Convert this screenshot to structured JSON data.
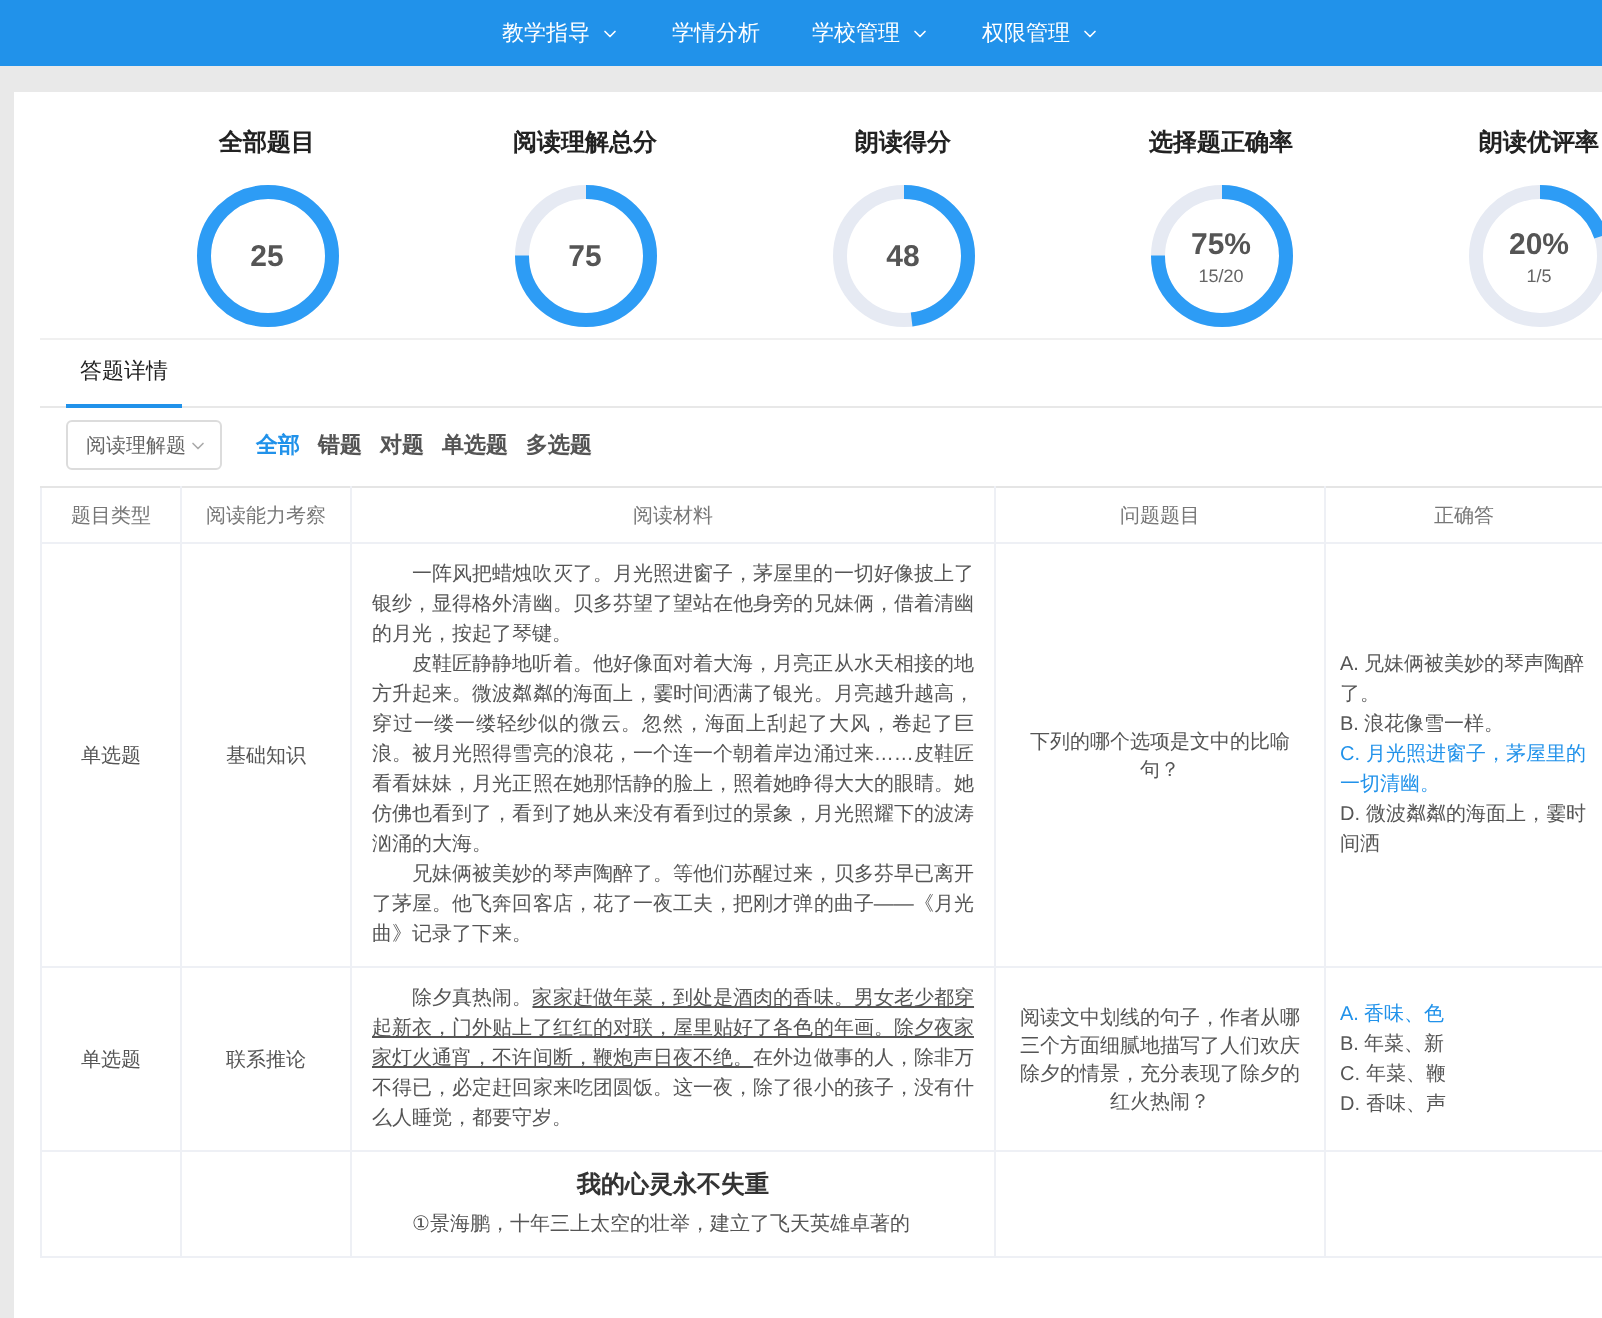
{
  "nav": {
    "items": [
      {
        "label": "教学指导",
        "dropdown": true
      },
      {
        "label": "学情分析",
        "dropdown": false
      },
      {
        "label": "学校管理",
        "dropdown": true
      },
      {
        "label": "权限管理",
        "dropdown": true
      }
    ]
  },
  "stats": [
    {
      "title": "全部题目",
      "value": "25",
      "level": 1
    },
    {
      "title": "阅读理解总分",
      "value": "75",
      "level": 0.75
    },
    {
      "title": "朗读得分",
      "value": "48",
      "level": 0.48
    },
    {
      "title": "选择题正确率",
      "value": "75%",
      "sub": "15/20",
      "level": 0.75
    },
    {
      "title": "朗读优评率",
      "value": "20%",
      "sub": "1/5",
      "level": 0.2
    }
  ],
  "tabs": [
    {
      "label": "答题详情",
      "selected": true
    }
  ],
  "filter": {
    "select_value": "阅读理解题",
    "options": [
      {
        "label": "全部",
        "selected": true
      },
      {
        "label": "错题",
        "selected": false
      },
      {
        "label": "对题",
        "selected": false
      },
      {
        "label": "单选题",
        "selected": false
      },
      {
        "label": "多选题",
        "selected": false
      }
    ]
  },
  "table": {
    "columns": [
      "题目类型",
      "阅读能力考察",
      "阅读材料",
      "问题题目",
      "正确答"
    ],
    "rows": [
      {
        "type": "单选题",
        "ability": "基础知识",
        "material": {
          "paragraphs": [
            [
              {
                "text": "一阵风把蜡烛吹灭了。月光照进窗子，茅屋里的一切好像披上了银纱，显得格外清幽。贝多芬望了望站在他身旁的兄妹俩，借着清幽的月光，按起了琴键。",
                "underline": false
              }
            ],
            [
              {
                "text": "皮鞋匠静静地听着。他好像面对着大海，月亮正从水天相接的地方升起来。微波粼粼的海面上，霎时间洒满了银光。月亮越升越高，穿过一缕一缕轻纱似的微云。忽然，海面上刮起了大风，卷起了巨浪。被月光照得雪亮的浪花，一个连一个朝着岸边涌过来……皮鞋匠看看妹妹，月光正照在她那恬静的脸上，照着她睁得大大的眼睛。她仿佛也看到了，看到了她从来没有看到过的景象，月光照耀下的波涛汹涌的大海。",
                "underline": false
              }
            ],
            [
              {
                "text": "兄妹俩被美妙的琴声陶醉了。等他们苏醒过来，贝多芬早已离开了茅屋。他飞奔回客店，花了一夜工夫，把刚才弹的曲子——《月光曲》记录了下来。",
                "underline": false
              }
            ]
          ]
        },
        "question": "下列的哪个选项是文中的比喻句？",
        "options": [
          {
            "text": "A. 兄妹俩被美妙的琴声陶醉了。",
            "correct": false
          },
          {
            "text": "B. 浪花像雪一样。",
            "correct": false
          },
          {
            "text": "C. 月光照进窗子，茅屋里的一切清幽。",
            "correct": true
          },
          {
            "text": "D. 微波粼粼的海面上，霎时间洒",
            "correct": false
          }
        ]
      },
      {
        "type": "单选题",
        "ability": "联系推论",
        "material": {
          "paragraphs": [
            [
              {
                "text": "除夕真热闹。",
                "underline": false
              },
              {
                "text": "家家赶做年菜，到处是酒肉的香味。男女老少都穿起新衣，门外贴上了红红的对联，屋里贴好了各色的年画。除夕夜家家灯火通宵，不许间断，鞭炮声日夜不绝。",
                "underline": true
              },
              {
                "text": "在外边做事的人，除非万不得已，必定赶回家来吃团圆饭。这一夜，除了很小的孩子，没有什么人睡觉，都要守岁。",
                "underline": false
              }
            ]
          ]
        },
        "question": "阅读文中划线的句子，作者从哪三个方面细腻地描写了人们欢庆除夕的情景，充分表现了除夕的红火热闹？",
        "options": [
          {
            "text": "A. 香味、色",
            "correct": true
          },
          {
            "text": "B. 年菜、新",
            "correct": false
          },
          {
            "text": "C. 年菜、鞭",
            "correct": false
          },
          {
            "text": "D. 香味、声",
            "correct": false
          }
        ]
      },
      {
        "material": {
          "title": "我的心灵永不失重",
          "paragraphs": [
            [
              {
                "text": "①景海鹏，十年三上太空的壮举，建立了飞天英雄卓著的",
                "underline": false
              }
            ]
          ]
        }
      }
    ]
  }
}
